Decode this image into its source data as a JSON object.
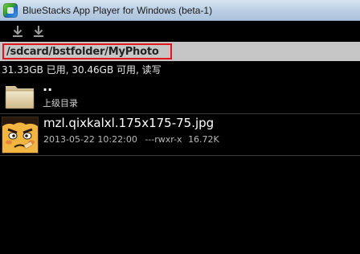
{
  "window": {
    "title": "BlueStacks App Player for Windows (beta-1)",
    "icon": "bluestacks-app-icon"
  },
  "toolbar": {
    "buttons": [
      {
        "icon": "download-icon"
      },
      {
        "icon": "download-icon"
      }
    ]
  },
  "path": {
    "current": "/sdcard/bstfolder/MyPhoto",
    "highlight_color": "#e0161e"
  },
  "storage": {
    "info": "31.33GB 已用, 30.46GB 可用, 读写"
  },
  "files": {
    "parent": {
      "name": "..",
      "label": "上级目录",
      "icon": "folder-icon"
    },
    "items": [
      {
        "name": "mzl.qixkalxl.175x175-75.jpg",
        "date": "2013-05-22 10:22:00",
        "permissions": "---rwxr-x",
        "size": "16.72K",
        "icon": "image-thumbnail-icon"
      }
    ]
  }
}
